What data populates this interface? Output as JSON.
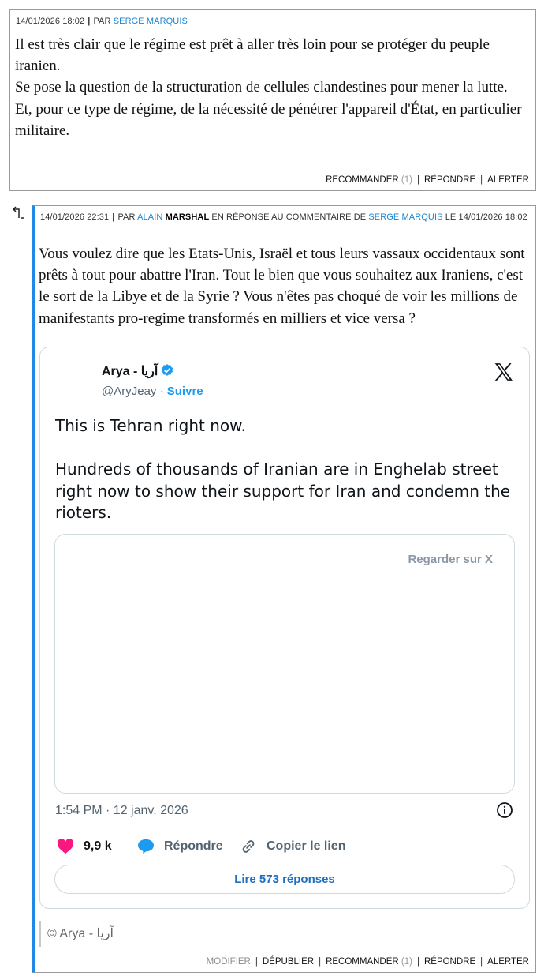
{
  "comment1": {
    "date": "14/01/2026 18:02",
    "par": "PAR",
    "author": "SERGE MARQUIS",
    "lines": [
      "Il est très clair que le régime est prêt à aller très loin pour se protéger du peuple iranien.",
      "Se pose la question de la structuration de cellules clandestines pour mener la lutte.",
      "Et, pour ce type de régime, de la nécessité de pénétrer l'appareil d'État, en particulier militaire."
    ],
    "actions": {
      "recommander": "RECOMMANDER",
      "recommander_count": "(1)",
      "repondre": "RÉPONDRE",
      "alerter": "ALERTER"
    }
  },
  "comment2": {
    "date": "14/01/2026 22:31",
    "par": "PAR",
    "author_first": "ALAIN",
    "author_last": "MARSHAL",
    "en_reponse": "EN RÉPONSE",
    "au_commentaire": "AU COMMENTAIRE",
    "de": "DE",
    "reply_to": "SERGE MARQUIS",
    "le": "LE",
    "reply_date": "14/01/2026 18:02",
    "text": "Vous voulez dire que les Etats-Unis, Israël et tous leurs vassaux occidentaux sont prêts à tout pour abattre l'Iran. Tout le bien que vous souhaitez aux Iraniens, c'est le sort de la Libye et de la Syrie ? Vous n'êtes pas choqué de voir les millions de manifestants pro-regime transformés en milliers et vice versa ?",
    "caption": "© Arya - آریا",
    "actions": {
      "modifier": "MODIFIER",
      "depublier": "DÉPUBLIER",
      "recommander": "RECOMMANDER",
      "recommander_count": "(1)",
      "repondre": "RÉPONDRE",
      "alerter": "ALERTER"
    }
  },
  "tweet": {
    "name": "Arya - آریا",
    "handle": "@AryJeay",
    "dot": "·",
    "follow": "Suivre",
    "line1": "This is Tehran right now.",
    "line2": "Hundreds of thousands of Iranian are in Enghelab street right now to show their support for Iran and condemn the rioters.",
    "watch": "Regarder sur X",
    "time": "1:54 PM · 12 janv. 2026",
    "likes": "9,9 k",
    "reply": "Répondre",
    "copy": "Copier le lien",
    "read": "Lire 573 réponses",
    "icons": [
      "verified-icon",
      "x-logo-icon",
      "info-icon",
      "heart-icon",
      "reply-bubble-icon",
      "link-icon"
    ],
    "colors": {
      "accent": "#1d9bf0",
      "heart": "#f91880",
      "reply": "#1d9bf0"
    }
  },
  "reply_arrow_icon": "reply-arrow-icon",
  "colors": {
    "reply_border": "#2288e6",
    "author_link": "#1a86d0"
  }
}
